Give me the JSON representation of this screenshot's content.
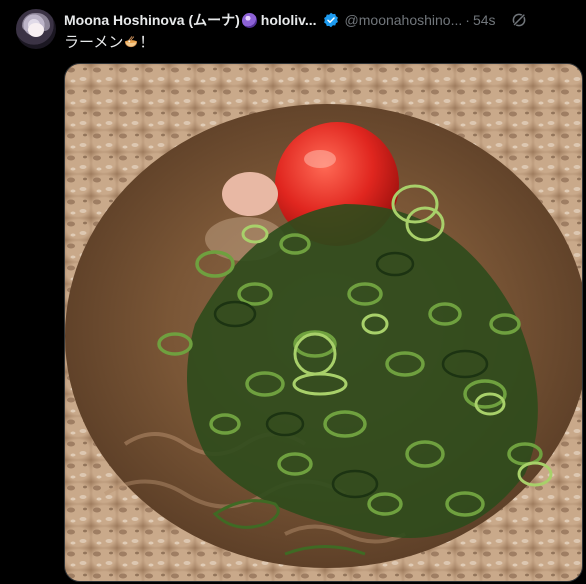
{
  "tweet": {
    "display_name": "Moona Hoshinova (ムーナ)",
    "org": "hololiv...",
    "handle": "@moonahoshino...",
    "separator": "·",
    "time": "54s",
    "text_before_emoji": "ラーメン",
    "text_after_emoji": "！",
    "name_emoji_icon": "purple-orb-icon",
    "text_emoji_icon": "ramen-bowl-icon",
    "verified_icon": "verified-badge-icon",
    "action_icon": "grok-icon",
    "photo_subject": "ramen-photo"
  },
  "colors": {
    "background": "#000000",
    "text": "#e7e9ea",
    "muted": "#71767b",
    "verified": "#1d9bf0"
  }
}
